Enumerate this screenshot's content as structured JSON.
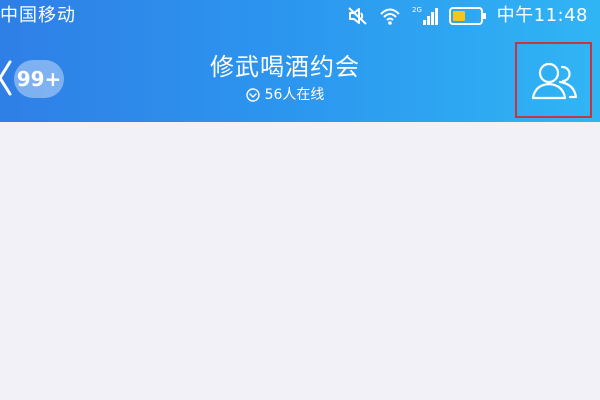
{
  "status_bar": {
    "carrier": "中国移动",
    "network_type": "2G",
    "time": "中午11:48",
    "icons": [
      "mute-icon",
      "wifi-icon",
      "signal-icon",
      "battery-icon"
    ]
  },
  "header": {
    "unread_count": "99+",
    "title": "修武喝酒约会",
    "online_text": "56人在线",
    "icons": [
      "back-icon",
      "online-status-icon",
      "members-icon"
    ]
  },
  "colors": {
    "header_gradient_start": "#2f7fe6",
    "header_gradient_end": "#30b5f4",
    "content_background": "#f1f1f7",
    "highlight_border": "#c5363e"
  }
}
